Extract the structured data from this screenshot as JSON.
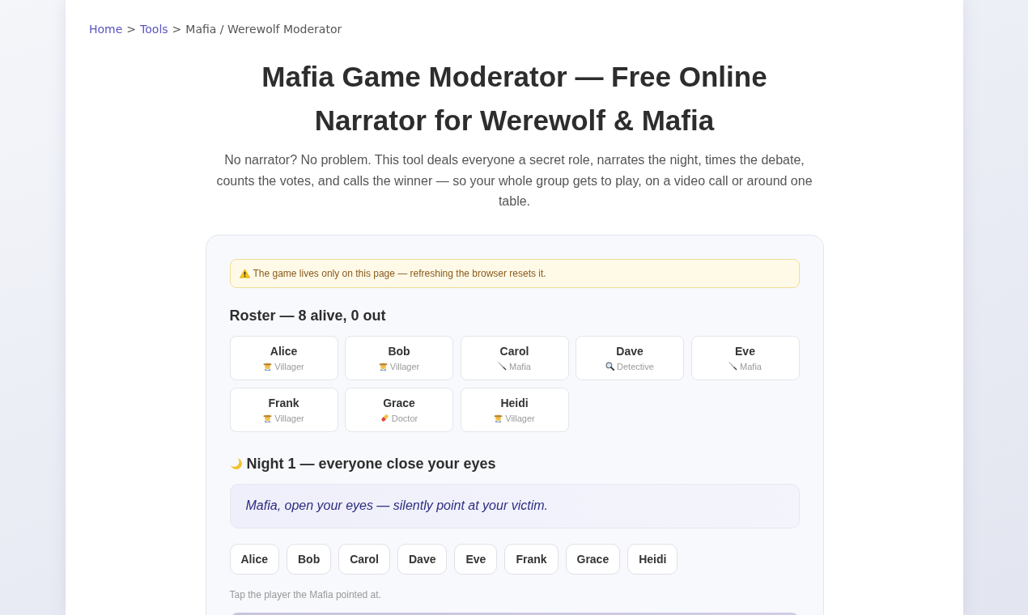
{
  "breadcrumb": [
    {
      "kind": "link",
      "label": "Home"
    },
    {
      "kind": "separator",
      "label": ">"
    },
    {
      "kind": "link",
      "label": "Tools"
    },
    {
      "kind": "separator",
      "label": ">"
    },
    {
      "kind": "current",
      "label": "Mafia / Werewolf Moderator"
    }
  ],
  "title": "Mafia Game Moderator — Free Online Narrator for Werewolf & Mafia",
  "intro": "No narrator? No problem. This tool deals everyone a secret role, narrates the night, times the debate, counts the votes, and calls the winner — so your whole group gets to play, on a video call or around one table.",
  "game": {
    "warning": {
      "text": "The game lives only on this page — refreshing the browser resets it."
    },
    "roster": {
      "heading": "Roster — 8 alive, 0 out",
      "players": [
        {
          "name": "Alice",
          "role": "Villager",
          "kind": "villager"
        },
        {
          "name": "Bob",
          "role": "Villager",
          "kind": "villager"
        },
        {
          "name": "Carol",
          "role": "Mafia",
          "kind": "mafia"
        },
        {
          "name": "Dave",
          "role": "Detective",
          "kind": "detective"
        },
        {
          "name": "Eve",
          "role": "Mafia",
          "kind": "mafia"
        },
        {
          "name": "Frank",
          "role": "Villager",
          "kind": "villager"
        },
        {
          "name": "Grace",
          "role": "Doctor",
          "kind": "doctor"
        },
        {
          "name": "Heidi",
          "role": "Villager",
          "kind": "villager"
        }
      ]
    },
    "night": {
      "heading": "Night 1 — everyone close your eyes",
      "prompt": "Mafia, open your eyes — silently point at your victim.",
      "targets": [
        "Alice",
        "Bob",
        "Carol",
        "Dave",
        "Eve",
        "Frank",
        "Grace",
        "Heidi"
      ],
      "hint": "Tap the player the Mafia pointed at."
    }
  }
}
